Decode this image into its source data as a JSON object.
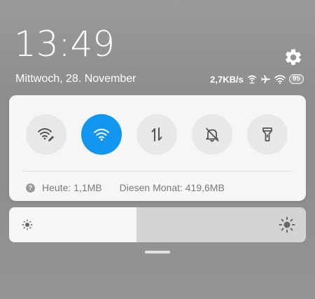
{
  "lockscreen": {
    "time": "13:49",
    "date": "Mittwoch, 28. November"
  },
  "statusbar": {
    "net_speed": "2,7KB/s",
    "battery_level": "95",
    "icons": [
      "hotspot-icon",
      "airplane-icon",
      "wifi-icon",
      "battery-icon"
    ]
  },
  "quick_settings": {
    "toggles": [
      {
        "name": "wifi-edit",
        "icon": "wifi-edit-icon",
        "active": false
      },
      {
        "name": "wifi",
        "icon": "wifi-icon",
        "active": true
      },
      {
        "name": "mobile-data",
        "icon": "data-transfer-icon",
        "active": false
      },
      {
        "name": "silent",
        "icon": "bell-off-icon",
        "active": false
      },
      {
        "name": "flashlight",
        "icon": "flashlight-icon",
        "active": false
      }
    ],
    "data_usage": {
      "today": "Heute: 1,1MB",
      "month": "Diesen Monat: 419,6MB"
    }
  },
  "brightness": {
    "level": 0.43
  },
  "colors": {
    "accent": "#1296f0",
    "panel": "#f6f6f6",
    "toggle_off": "#e8e8e8"
  }
}
